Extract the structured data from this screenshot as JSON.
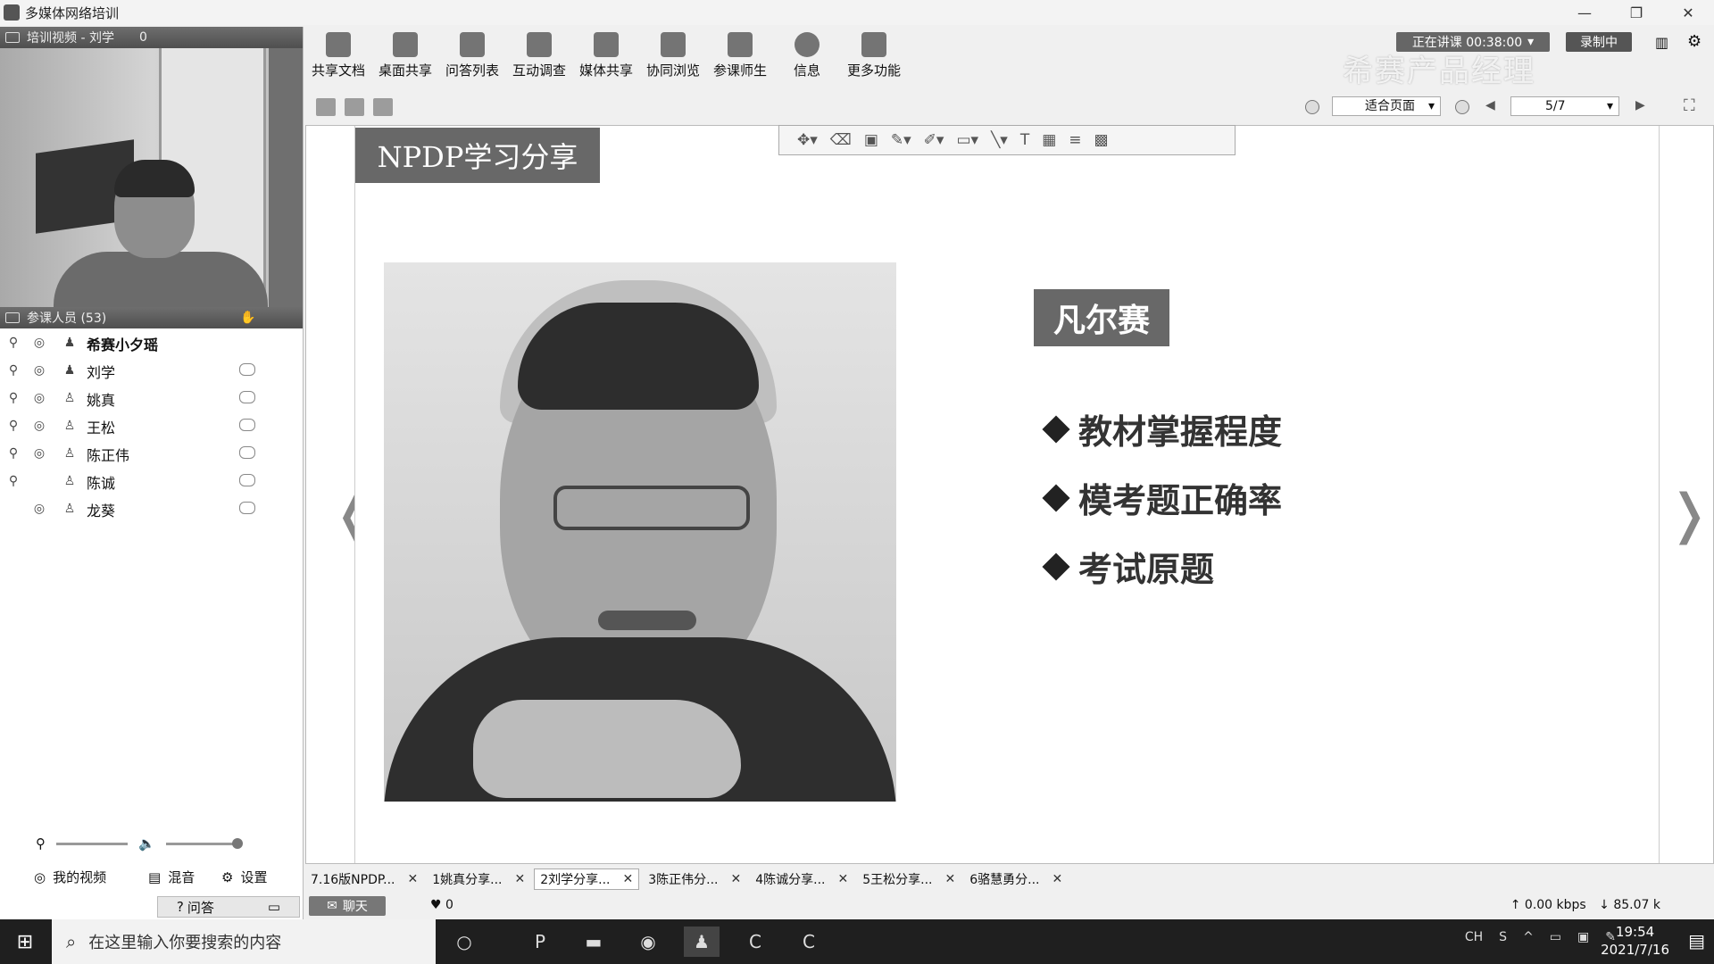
{
  "window": {
    "title": "多媒体网络培训",
    "controls": [
      "—",
      "❐",
      "✕"
    ]
  },
  "left_panel": {
    "video_header": "培训视频 - 刘学",
    "video_count": "0",
    "participants_header": "参课人员 (53)",
    "participants": [
      {
        "name": "希赛小夕瑶",
        "host": true
      },
      {
        "name": "刘学"
      },
      {
        "name": "姚真"
      },
      {
        "name": "王松"
      },
      {
        "name": "陈正伟"
      },
      {
        "name": "陈诚"
      },
      {
        "name": "龙葵"
      }
    ],
    "my_video_label": "我的视频",
    "mix_label": "混音",
    "settings_label": "设置",
    "qa_label": "问答"
  },
  "toolbar": {
    "items": [
      "共享文档",
      "桌面共享",
      "问答列表",
      "互动调查",
      "媒体共享",
      "协同浏览",
      "参课师生",
      "信息",
      "更多功能"
    ],
    "status": "正在讲课 00:38:00",
    "record": "录制中",
    "watermark": "希赛产品经理"
  },
  "subbar": {
    "zoom": "适合页面",
    "page": "5/7"
  },
  "slide": {
    "title": "NPDP学习分享",
    "name": "凡尔赛",
    "bullets": [
      "教材掌握程度",
      "模考题正确率",
      "考试原题"
    ]
  },
  "doc_tabs": [
    {
      "label": "7.16版NPDP...",
      "active": false
    },
    {
      "label": "1姚真分享...",
      "active": false
    },
    {
      "label": "2刘学分享...",
      "active": true
    },
    {
      "label": "3陈正伟分...",
      "active": false
    },
    {
      "label": "4陈诚分享...",
      "active": false
    },
    {
      "label": "5王松分享...",
      "active": false
    },
    {
      "label": "6骆慧勇分...",
      "active": false
    }
  ],
  "bottom": {
    "chat": "聊天",
    "likes": "0",
    "upload": "0.00 kbps",
    "download": "85.07 k"
  },
  "taskbar": {
    "search_placeholder": "在这里输入你要搜索的内容",
    "lang": "CH",
    "time": "19:54",
    "date": "2021/7/16"
  }
}
